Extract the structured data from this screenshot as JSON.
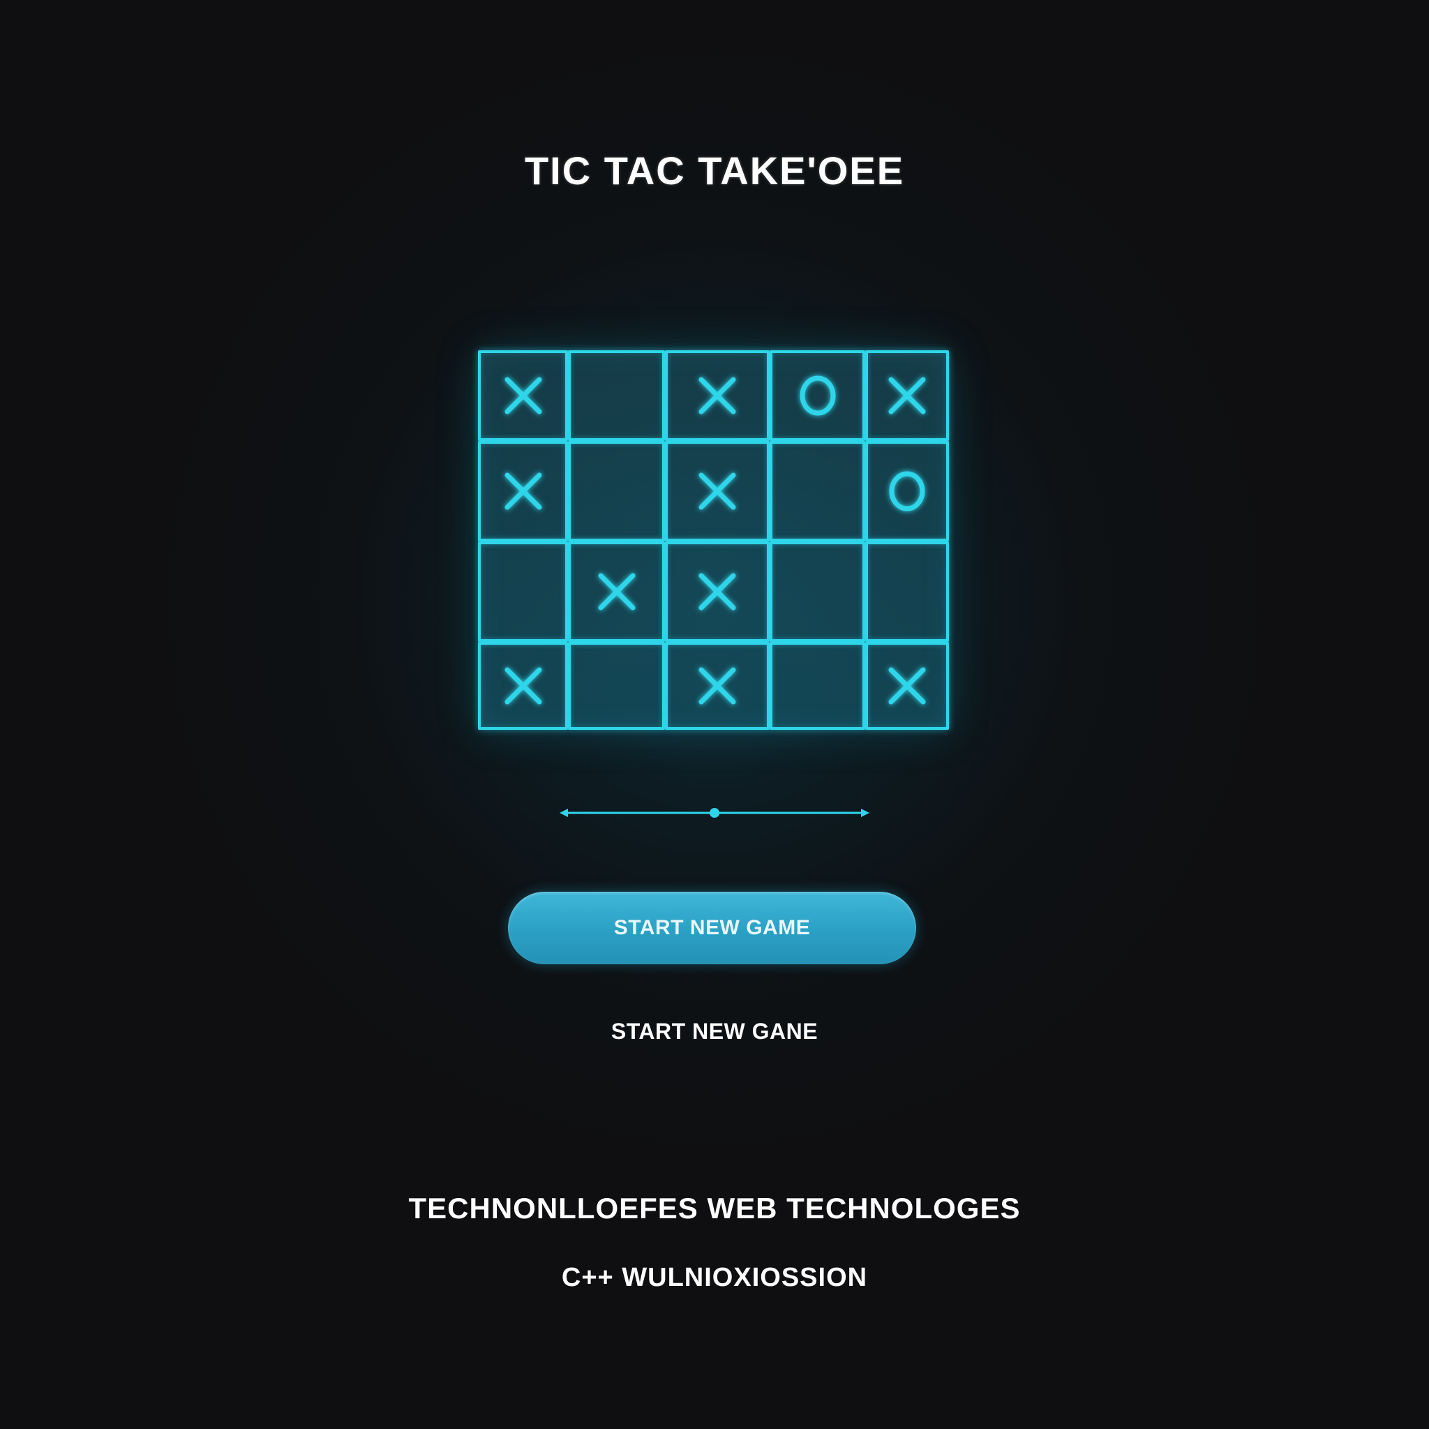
{
  "title": "TIC TAC TAKE'OEE",
  "board": {
    "rows": 4,
    "cols": 5,
    "cells": [
      [
        "X",
        "",
        "X",
        "O",
        "X"
      ],
      [
        "X",
        "",
        "X",
        "",
        "O"
      ],
      [
        "",
        "X",
        "X",
        "",
        ""
      ],
      [
        "X",
        "",
        "X",
        "",
        "X"
      ]
    ]
  },
  "slider": {
    "position": 0.5
  },
  "primary_button": {
    "label": "START NEW GAME"
  },
  "secondary_link": {
    "label": "START NEW GANE"
  },
  "footer": {
    "technologies": "TECHNONLLOEFES WEB TECHNOLOGES",
    "language": "C++ WULNIOXIOSSION"
  },
  "colors": {
    "accent": "#2fd6ea",
    "button": "#2aa0c4",
    "background": "#0f0f11",
    "text": "#ffffff"
  }
}
